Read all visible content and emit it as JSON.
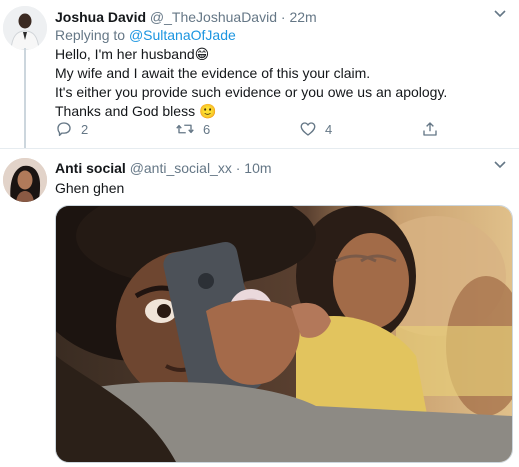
{
  "tweets": [
    {
      "name": "Joshua David",
      "handle": "@_TheJoshuaDavid",
      "sep": "·",
      "time": "22m",
      "replying_label": "Replying to",
      "replying_to": "@SultanaOfJade",
      "lines": [
        "Hello, I'm her husband",
        "My wife and I await the evidence of this your claim.",
        "It's either you provide such evidence or you owe us an apology.",
        "Thanks and God bless"
      ],
      "emoji_line1": "😁",
      "emoji_line4": "🙂",
      "actions": {
        "replies": "2",
        "retweets": "6",
        "likes": "4"
      }
    },
    {
      "name": "Anti social",
      "handle": "@anti_social_xx",
      "sep": "·",
      "time": "10m",
      "text": "Ghen ghen"
    }
  ],
  "icons": {
    "more": "chevron-down-icon",
    "reply": "reply-icon",
    "retweet": "retweet-icon",
    "like": "heart-icon",
    "share": "share-icon"
  },
  "colors": {
    "link": "#1b95e0",
    "muted": "#657786",
    "thread_line": "#ccd6dd"
  }
}
